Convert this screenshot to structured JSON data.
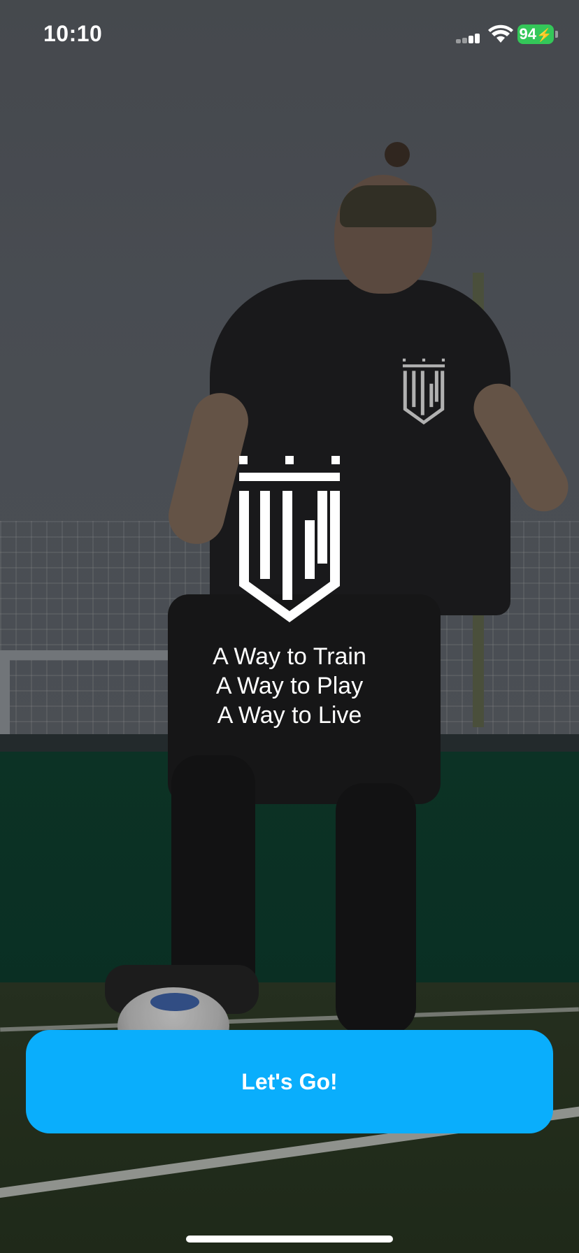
{
  "status_bar": {
    "time": "10:10",
    "battery_level": "94",
    "battery_state": "charging",
    "icons": [
      "cellular-signal-icon",
      "wifi-icon",
      "battery-icon"
    ]
  },
  "brand": {
    "logo": "ww-crown-shield-logo",
    "tagline": [
      "A Way to Train",
      "A Way to Play",
      "A Way to Live"
    ]
  },
  "cta": {
    "label": "Let's Go!"
  },
  "colors": {
    "accent": "#0aaefc",
    "battery": "#34c759",
    "text": "#ffffff"
  }
}
